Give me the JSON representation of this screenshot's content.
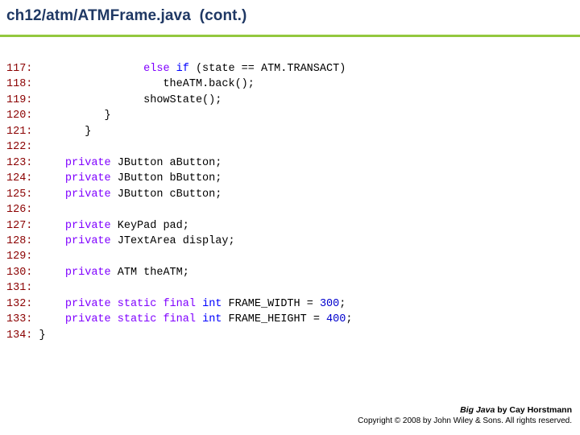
{
  "slide": {
    "title": "ch12/atm/ATMFrame.java  (cont.)",
    "accent_color": "#93c83e",
    "title_color": "#1f3864",
    "code_lines": [
      {
        "num": "117:",
        "segments": [
          {
            "t": "                 ",
            "c": "plain"
          },
          {
            "t": "else",
            "c": "kw"
          },
          {
            "t": " ",
            "c": "plain"
          },
          {
            "t": "if",
            "c": "kw2"
          },
          {
            "t": " (state == ATM.TRANSACT)",
            "c": "plain"
          }
        ]
      },
      {
        "num": "118:",
        "segments": [
          {
            "t": "                    the",
            "c": "plain"
          },
          {
            "t": "ATM",
            "c": "plain"
          },
          {
            "t": ".back();",
            "c": "plain"
          }
        ]
      },
      {
        "num": "119:",
        "segments": [
          {
            "t": "                 showState();",
            "c": "plain"
          }
        ]
      },
      {
        "num": "120:",
        "segments": [
          {
            "t": "           }",
            "c": "plain"
          }
        ]
      },
      {
        "num": "121:",
        "segments": [
          {
            "t": "        }",
            "c": "plain"
          }
        ]
      },
      {
        "num": "122:",
        "segments": [
          {
            "t": "",
            "c": "plain"
          }
        ]
      },
      {
        "num": "123:",
        "segments": [
          {
            "t": "     ",
            "c": "plain"
          },
          {
            "t": "private",
            "c": "kw"
          },
          {
            "t": " JButton aButton;",
            "c": "plain"
          }
        ]
      },
      {
        "num": "124:",
        "segments": [
          {
            "t": "     ",
            "c": "plain"
          },
          {
            "t": "private",
            "c": "kw"
          },
          {
            "t": " JButton bButton;",
            "c": "plain"
          }
        ]
      },
      {
        "num": "125:",
        "segments": [
          {
            "t": "     ",
            "c": "plain"
          },
          {
            "t": "private",
            "c": "kw"
          },
          {
            "t": " JButton cButton;",
            "c": "plain"
          }
        ]
      },
      {
        "num": "126:",
        "segments": [
          {
            "t": "",
            "c": "plain"
          }
        ]
      },
      {
        "num": "127:",
        "segments": [
          {
            "t": "     ",
            "c": "plain"
          },
          {
            "t": "private",
            "c": "kw"
          },
          {
            "t": " KeyPad pad;",
            "c": "plain"
          }
        ]
      },
      {
        "num": "128:",
        "segments": [
          {
            "t": "     ",
            "c": "plain"
          },
          {
            "t": "private",
            "c": "kw"
          },
          {
            "t": " JTextArea display;",
            "c": "plain"
          }
        ]
      },
      {
        "num": "129:",
        "segments": [
          {
            "t": "",
            "c": "plain"
          }
        ]
      },
      {
        "num": "130:",
        "segments": [
          {
            "t": "     ",
            "c": "plain"
          },
          {
            "t": "private",
            "c": "kw"
          },
          {
            "t": " ATM theATM;",
            "c": "plain"
          }
        ]
      },
      {
        "num": "131:",
        "segments": [
          {
            "t": "",
            "c": "plain"
          }
        ]
      },
      {
        "num": "132:",
        "segments": [
          {
            "t": "     ",
            "c": "plain"
          },
          {
            "t": "private",
            "c": "kw"
          },
          {
            "t": " ",
            "c": "plain"
          },
          {
            "t": "static",
            "c": "kw"
          },
          {
            "t": " ",
            "c": "plain"
          },
          {
            "t": "final",
            "c": "kw"
          },
          {
            "t": " ",
            "c": "plain"
          },
          {
            "t": "int",
            "c": "kw2"
          },
          {
            "t": " FRAME_WIDTH = ",
            "c": "plain"
          },
          {
            "t": "300",
            "c": "num"
          },
          {
            "t": ";",
            "c": "plain"
          }
        ]
      },
      {
        "num": "133:",
        "segments": [
          {
            "t": "     ",
            "c": "plain"
          },
          {
            "t": "private",
            "c": "kw"
          },
          {
            "t": " ",
            "c": "plain"
          },
          {
            "t": "static",
            "c": "kw"
          },
          {
            "t": " ",
            "c": "plain"
          },
          {
            "t": "final",
            "c": "kw"
          },
          {
            "t": " ",
            "c": "plain"
          },
          {
            "t": "int",
            "c": "kw2"
          },
          {
            "t": " FRAME_HEIGHT = ",
            "c": "plain"
          },
          {
            "t": "400",
            "c": "num"
          },
          {
            "t": ";",
            "c": "plain"
          }
        ]
      },
      {
        "num": "134:",
        "segments": [
          {
            "t": " }",
            "c": "plain"
          }
        ]
      }
    ],
    "footer": {
      "book_title": "Big Java",
      "author_line": " by Cay Horstmann",
      "copyright": "Copyright © 2008 by John Wiley & Sons.  All rights reserved."
    }
  }
}
